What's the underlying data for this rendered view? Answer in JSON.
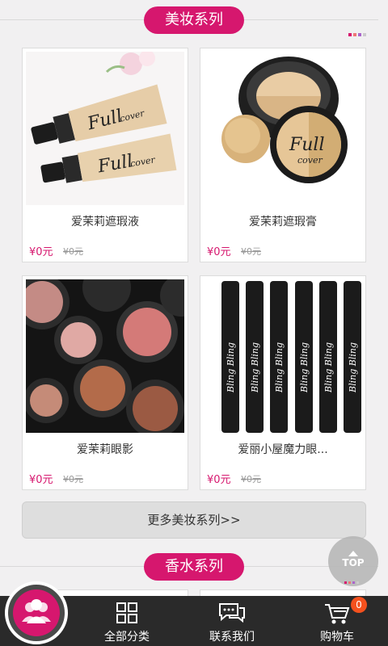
{
  "section1": {
    "title": "美妆系列"
  },
  "products": [
    {
      "name": "爱茉莉遮瑕液",
      "price": "¥0元",
      "old_price": "¥0元"
    },
    {
      "name": "爱茉莉遮瑕膏",
      "price": "¥0元",
      "old_price": "¥0元"
    },
    {
      "name": "爱茉莉眼影",
      "price": "¥0元",
      "old_price": "¥0元"
    },
    {
      "name": "爱丽小屋魔力眼...",
      "price": "¥0元",
      "old_price": "¥0元"
    }
  ],
  "more_button": {
    "label": "更多美妆系列>>"
  },
  "section2": {
    "title": "香水系列"
  },
  "top_button": {
    "label": "TOP"
  },
  "tabbar": {
    "categories_label": "全部分类",
    "contact_label": "联系我们",
    "cart_label": "购物车",
    "cart_count": "0"
  },
  "colors": {
    "accent": "#d6176e",
    "tabbar_bg": "#2a2a2a",
    "badge": "#f4511e"
  },
  "icons": [
    "user-group-icon",
    "grid-icon",
    "chat-icon",
    "cart-icon",
    "arrow-up-icon"
  ]
}
